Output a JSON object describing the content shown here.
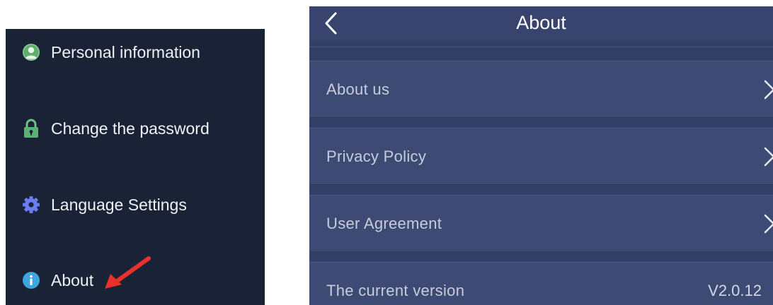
{
  "sidebar": {
    "items": [
      {
        "label": "Personal information",
        "icon": "person-icon"
      },
      {
        "label": "Change the password",
        "icon": "lock-icon"
      },
      {
        "label": "Language Settings",
        "icon": "gear-icon"
      },
      {
        "label": "About",
        "icon": "info-icon"
      }
    ],
    "colors": {
      "background": "#1a2236",
      "text": "#eef0f4",
      "annotation_arrow": "#e8312a"
    }
  },
  "about_screen": {
    "title": "About",
    "back_icon": "chevron-left-icon",
    "rows": [
      {
        "label": "About us",
        "icon": "chevron-right-icon"
      },
      {
        "label": "Privacy Policy",
        "icon": "chevron-right-icon"
      },
      {
        "label": "User Agreement",
        "icon": "chevron-right-icon"
      }
    ],
    "version": {
      "label": "The current version",
      "value": "V2.0.12"
    },
    "colors": {
      "background": "#333f66",
      "row": "#3d4a74",
      "text": "#c7ccdb"
    }
  }
}
